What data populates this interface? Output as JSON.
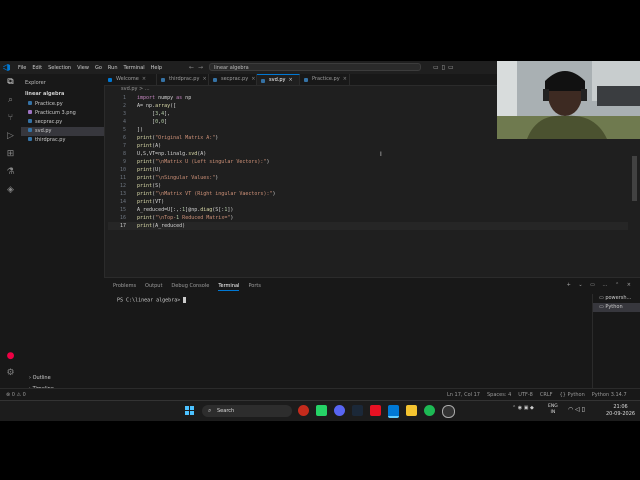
{
  "window": {
    "menu": [
      "File",
      "Edit",
      "Selection",
      "View",
      "Go",
      "Run",
      "Terminal",
      "Help"
    ],
    "search": "linear algebra"
  },
  "sidebar": {
    "header": "Explorer",
    "folder": "linear algebra",
    "files": [
      {
        "name": "Practice.py",
        "type": "py"
      },
      {
        "name": "Practicum 3.png",
        "type": "png"
      },
      {
        "name": "secprac.py",
        "type": "py"
      },
      {
        "name": "svd.py",
        "type": "py",
        "active": true
      },
      {
        "name": "thirdprac.py",
        "type": "py"
      }
    ],
    "outline": "Outline",
    "timeline": "Timeline"
  },
  "tabs": [
    {
      "label": "Welcome"
    },
    {
      "label": "thirdprac.py"
    },
    {
      "label": "secprac.py"
    },
    {
      "label": "svd.py",
      "active": true
    },
    {
      "label": "Practice.py"
    }
  ],
  "breadcrumb": "svd.py > ...",
  "editor": {
    "lines": [
      {
        "n": "1",
        "text": "import numpy as np"
      },
      {
        "n": "2",
        "text": "A= np.array(["
      },
      {
        "n": "3",
        "text": "     [3,4],"
      },
      {
        "n": "4",
        "text": "     [0,0]"
      },
      {
        "n": "5",
        "text": "])"
      },
      {
        "n": "6",
        "text": "print(\"Original Matrix A:\")"
      },
      {
        "n": "7",
        "text": "print(A)"
      },
      {
        "n": "8",
        "text": "U,S,VT=np.linalg.svd(A)"
      },
      {
        "n": "9",
        "text": "print(\"\\nMatrix U (Left singular Vectors):\")"
      },
      {
        "n": "10",
        "text": "print(U)"
      },
      {
        "n": "11",
        "text": "print(\"\\nSingular Values:\")"
      },
      {
        "n": "12",
        "text": "print(S)"
      },
      {
        "n": "13",
        "text": "print(\"\\nMatrix VT (Right ingular Vaectors):\")"
      },
      {
        "n": "14",
        "text": "print(VT)"
      },
      {
        "n": "15",
        "text": "A_reduced=U[:,:1]@np.diag(S[:1])"
      },
      {
        "n": "16",
        "text": "print(\"\\nTop-1 Reduced Matrix=\")"
      },
      {
        "n": "17",
        "text": "print(A_reduced)",
        "current": true
      }
    ]
  },
  "panel": {
    "tabs": [
      "Problems",
      "Output",
      "Debug Console",
      "Terminal",
      "Ports"
    ],
    "active_tab": "Terminal",
    "prompt": "PS C:\\linear algebra>",
    "terminals": [
      "powersh...",
      "Python"
    ]
  },
  "status": {
    "left": "⊗ 0 ⚠ 0",
    "items": [
      "Ln 17, Col 17",
      "Spaces: 4",
      "UTF-8",
      "CRLF",
      "{} Python",
      "Python 3.14.7"
    ]
  },
  "taskbar": {
    "search": "Search",
    "lang_top": "ENG",
    "lang_bottom": "IN",
    "time": "21:06",
    "date": "20-09-2026"
  }
}
